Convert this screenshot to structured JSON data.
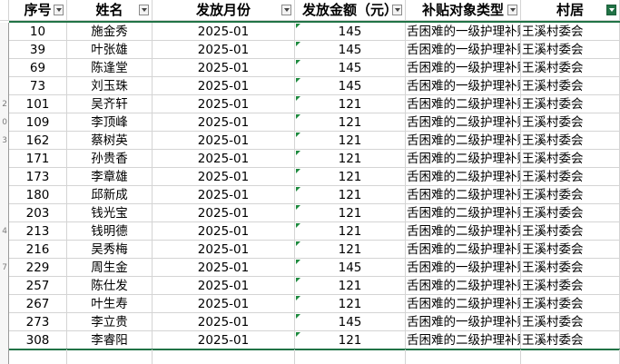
{
  "header": {
    "columns": [
      {
        "label": "序号",
        "filter_icon": "dropdown-arrow-icon"
      },
      {
        "label": "姓名",
        "filter_icon": "dropdown-arrow-icon"
      },
      {
        "label": "发放月份",
        "filter_icon": "dropdown-arrow-icon"
      },
      {
        "label": "发放金额（元）",
        "filter_icon": "dropdown-arrow-icon"
      },
      {
        "label": "补贴对象类型",
        "filter_icon": "dropdown-arrow-icon"
      },
      {
        "label": "村居",
        "filter_icon": "filter-applied-icon"
      }
    ]
  },
  "row_headers": [
    "",
    "",
    "",
    "",
    "2",
    "0",
    "3",
    "",
    "",
    "",
    "",
    "4",
    "",
    "7",
    "",
    "",
    "",
    "",
    ""
  ],
  "rows": [
    {
      "no": "10",
      "name": "施金秀",
      "month": "2025-01",
      "amount": "145",
      "type": "舌困难的一级护理补贴",
      "village": "王溪村委会"
    },
    {
      "no": "39",
      "name": "叶张雄",
      "month": "2025-01",
      "amount": "145",
      "type": "舌困难的一级护理补贴",
      "village": "王溪村委会"
    },
    {
      "no": "69",
      "name": "陈逢堂",
      "month": "2025-01",
      "amount": "145",
      "type": "舌困难的一级护理补贴",
      "village": "王溪村委会"
    },
    {
      "no": "73",
      "name": "刘玉珠",
      "month": "2025-01",
      "amount": "145",
      "type": "舌困难的一级护理补贴",
      "village": "王溪村委会"
    },
    {
      "no": "101",
      "name": "吴齐轩",
      "month": "2025-01",
      "amount": "121",
      "type": "舌困难的二级护理补贴",
      "village": "王溪村委会"
    },
    {
      "no": "109",
      "name": "李顶峰",
      "month": "2025-01",
      "amount": "121",
      "type": "舌困难的二级护理补贴",
      "village": "王溪村委会"
    },
    {
      "no": "162",
      "name": "蔡树英",
      "month": "2025-01",
      "amount": "121",
      "type": "舌困难的二级护理补贴",
      "village": "王溪村委会"
    },
    {
      "no": "171",
      "name": "孙贵香",
      "month": "2025-01",
      "amount": "121",
      "type": "舌困难的二级护理补贴",
      "village": "王溪村委会"
    },
    {
      "no": "173",
      "name": "李章雄",
      "month": "2025-01",
      "amount": "121",
      "type": "舌困难的二级护理补贴",
      "village": "王溪村委会"
    },
    {
      "no": "180",
      "name": "邱新成",
      "month": "2025-01",
      "amount": "121",
      "type": "舌困难的二级护理补贴",
      "village": "王溪村委会"
    },
    {
      "no": "203",
      "name": "钱光宝",
      "month": "2025-01",
      "amount": "121",
      "type": "舌困难的二级护理补贴",
      "village": "王溪村委会"
    },
    {
      "no": "213",
      "name": "钱明德",
      "month": "2025-01",
      "amount": "121",
      "type": "舌困难的二级护理补贴",
      "village": "王溪村委会"
    },
    {
      "no": "216",
      "name": "吴秀梅",
      "month": "2025-01",
      "amount": "121",
      "type": "舌困难的二级护理补贴",
      "village": "王溪村委会"
    },
    {
      "no": "229",
      "name": "周生金",
      "month": "2025-01",
      "amount": "145",
      "type": "舌困难的一级护理补贴",
      "village": "王溪村委会"
    },
    {
      "no": "257",
      "name": "陈仕发",
      "month": "2025-01",
      "amount": "121",
      "type": "舌困难的二级护理补贴",
      "village": "王溪村委会"
    },
    {
      "no": "267",
      "name": "叶生寿",
      "month": "2025-01",
      "amount": "121",
      "type": "舌困难的二级护理补贴",
      "village": "王溪村委会"
    },
    {
      "no": "273",
      "name": "李立贵",
      "month": "2025-01",
      "amount": "145",
      "type": "舌困难的一级护理补贴",
      "village": "王溪村委会"
    },
    {
      "no": "308",
      "name": "李睿阳",
      "month": "2025-01",
      "amount": "121",
      "type": "舌困难的二级护理补贴",
      "village": "王溪村委会"
    }
  ],
  "colors": {
    "accent": "#217346",
    "gridline": "#d4d4d4",
    "error_triangle": "#1d8a3e"
  }
}
